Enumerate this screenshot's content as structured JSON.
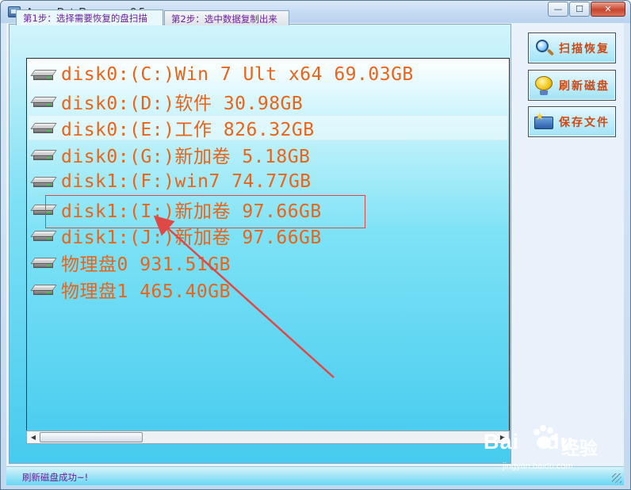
{
  "window": {
    "title": "AuroraDataRecovery v2.5",
    "minimize_glyph": "—",
    "maximize_glyph": "☐",
    "close_glyph": "✕"
  },
  "tabs": [
    {
      "label": "第1步：选择需要恢复的盘扫描",
      "active": true
    },
    {
      "label": "第2步：选中数据复制出来",
      "active": false
    }
  ],
  "disks": [
    {
      "label": "disk0:(C:)Win 7 Ult x64 69.03GB",
      "selected": false
    },
    {
      "label": "disk0:(D:)软件 30.98GB",
      "selected": false
    },
    {
      "label": "disk0:(E:)工作 826.32GB",
      "selected": true
    },
    {
      "label": "disk0:(G:)新加卷 5.18GB",
      "selected": false
    },
    {
      "label": "disk1:(F:)win7 74.77GB",
      "selected": false
    },
    {
      "label": "disk1:(I:)新加卷 97.66GB",
      "selected": false
    },
    {
      "label": "disk1:(J:)新加卷 97.66GB",
      "selected": false
    },
    {
      "label": "物理盘0 931.51GB",
      "selected": false
    },
    {
      "label": "物理盘1 465.40GB",
      "selected": false
    }
  ],
  "scrollbar": {
    "left_arrow": "◀",
    "right_arrow": "▶"
  },
  "actions": {
    "scan_label": "扫描恢复",
    "refresh_label": "刷新磁盘",
    "save_label": "保存文件"
  },
  "status": {
    "text": "刷新磁盘成功~!"
  },
  "watermark": {
    "logo": "Bai",
    "logo_suffix": "du",
    "cn": "经验",
    "url": "jingyan.baidu.com"
  },
  "colors": {
    "disk_text": "#e8641a",
    "button_text": "#cc4a16",
    "tab_text": "#6a1f9a",
    "annotation": "#e04848"
  }
}
